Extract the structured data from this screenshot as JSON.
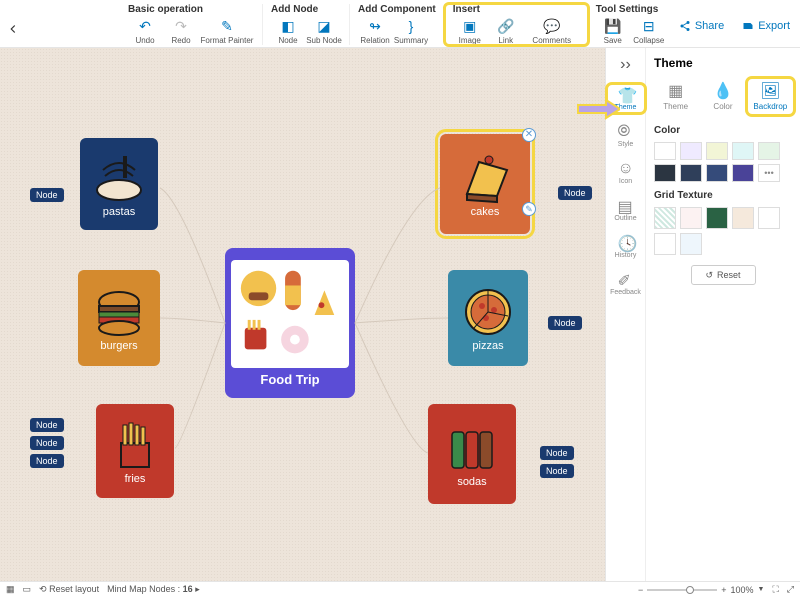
{
  "toolbar": {
    "groups": [
      {
        "title": "Basic operation",
        "items": [
          "Undo",
          "Redo",
          "Format Painter"
        ]
      },
      {
        "title": "Add Node",
        "items": [
          "Node",
          "Sub Node"
        ]
      },
      {
        "title": "Add Component",
        "items": [
          "Relation",
          "Summary"
        ]
      },
      {
        "title": "Insert",
        "items": [
          "Image",
          "Link",
          "Comments"
        ]
      },
      {
        "title": "Tool Settings",
        "items": [
          "Save",
          "Collapse"
        ]
      }
    ],
    "share": "Share",
    "export": "Export"
  },
  "canvas": {
    "center": {
      "label": "Food Trip"
    },
    "nodes": {
      "pastas": "pastas",
      "burgers": "burgers",
      "fries": "fries",
      "cakes": "cakes",
      "pizzas": "pizzas",
      "sodas": "sodas"
    },
    "node_btn": "Node"
  },
  "sidepanel": {
    "title": "Theme",
    "tabs": [
      "Theme",
      "Color",
      "Backdrop"
    ],
    "icons": [
      "Theme",
      "Style",
      "Icon",
      "Outline",
      "History",
      "Feedback"
    ],
    "color_title": "Color",
    "grid_title": "Grid Texture",
    "colors_row1": [
      "#ffffff",
      "#efeaff",
      "#f2f5d6",
      "#dff6f6",
      "#e5f4e6"
    ],
    "colors_row2": [
      "#2b3541",
      "#2f3f5a",
      "#354b7a",
      "#4a4398",
      "#ffffff"
    ],
    "textures": [
      "#e8f3f0",
      "#fcf2f2",
      "#2a6244",
      "#f5e9dc",
      "#fff",
      "#fff",
      "#eef6fc"
    ],
    "reset": "Reset"
  },
  "statusbar": {
    "reset_layout": "Reset layout",
    "nodes_label": "Mind Map Nodes :",
    "node_count": "16",
    "zoom": "100%"
  }
}
